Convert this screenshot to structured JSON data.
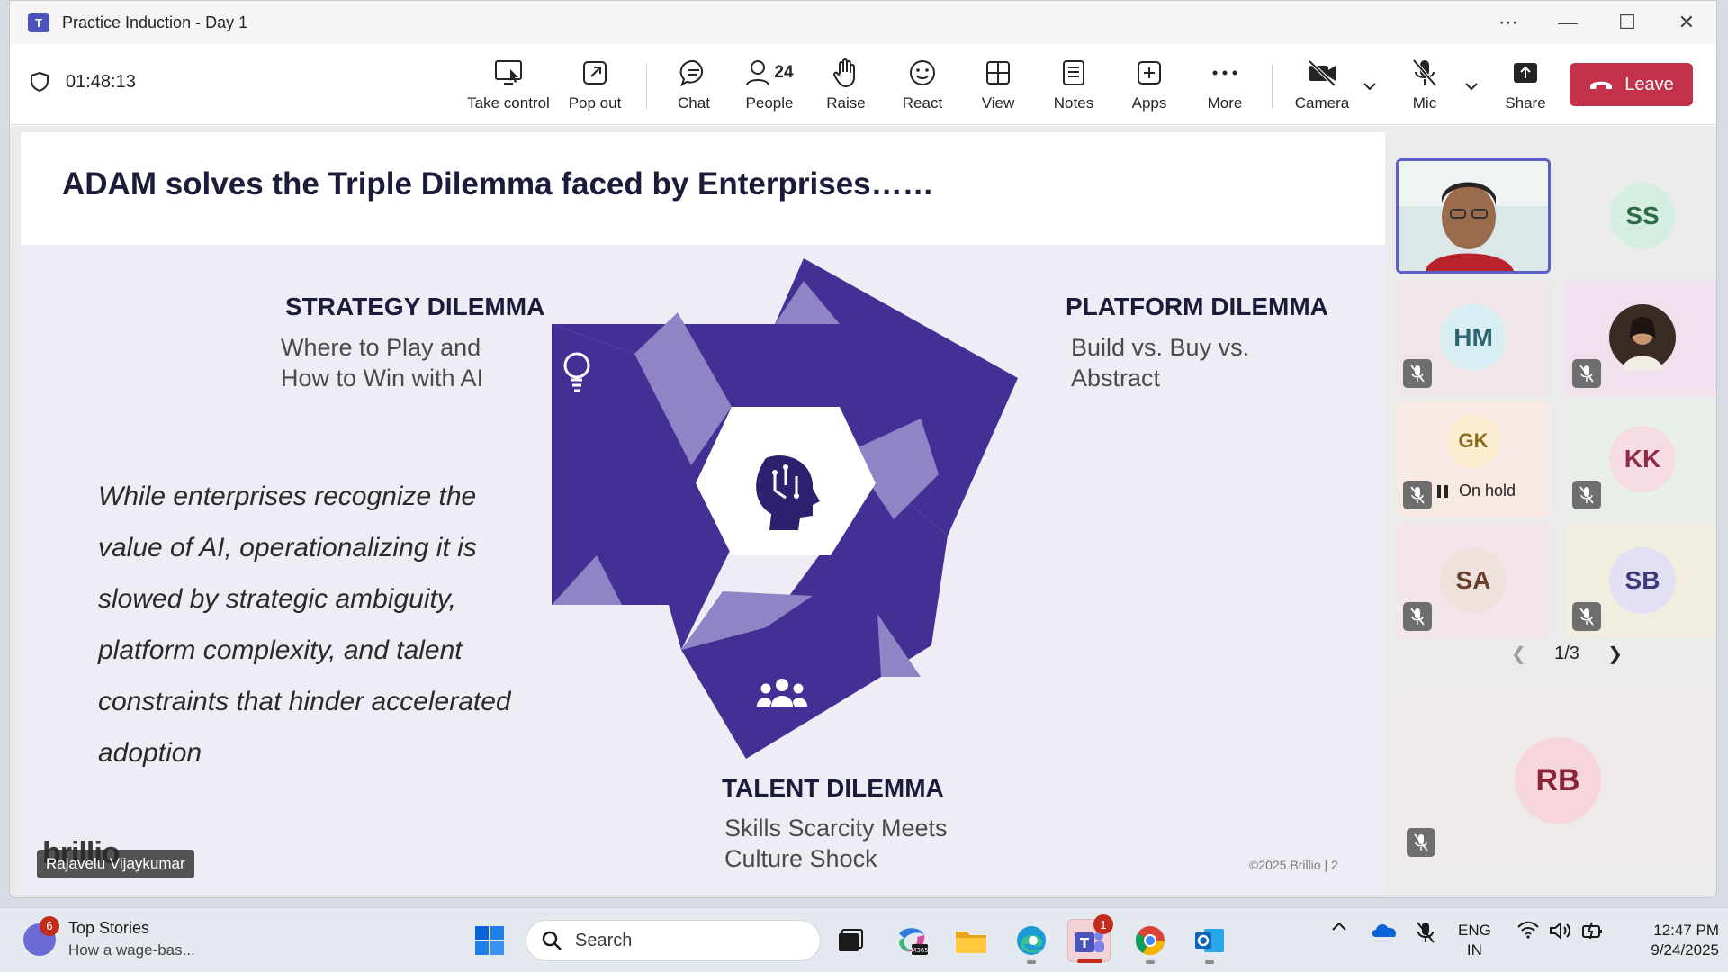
{
  "window": {
    "title": "Practice Induction - Day 1",
    "controls": [
      "…",
      "—",
      "☐",
      "✕"
    ]
  },
  "meeting": {
    "timer": "01:48:13",
    "toolbar": {
      "take_control": "Take control",
      "pop_out": "Pop out",
      "chat": "Chat",
      "people": "People",
      "people_count": "24",
      "raise": "Raise",
      "react": "React",
      "view": "View",
      "notes": "Notes",
      "apps": "Apps",
      "more": "More",
      "camera": "Camera",
      "mic": "Mic",
      "share": "Share",
      "leave": "Leave"
    }
  },
  "slide": {
    "title": "ADAM solves the Triple Dilemma faced by Enterprises……",
    "strategy": {
      "title": "STRATEGY DILEMMA",
      "line1": "Where to Play and",
      "line2": "How to Win with AI"
    },
    "platform": {
      "title": "PLATFORM DILEMMA",
      "line1": "Build vs. Buy vs.",
      "line2": "Abstract"
    },
    "talent": {
      "title": "TALENT DILEMMA",
      "line1": "Skills Scarcity Meets",
      "line2": "Culture Shock"
    },
    "quote": "While enterprises recognize the value of AI, operationalizing it is slowed by strategic ambiguity, platform complexity, and talent constraints that hinder accelerated adoption",
    "copyright": "©2025 Brillio  |  2",
    "logo": "brillio",
    "presenter": "Rajavelu Vijaykumar",
    "colors": {
      "primary": "#442f94",
      "light": "#8f85c6"
    }
  },
  "participants": {
    "tiles": [
      {
        "initials": "",
        "video": true
      },
      {
        "initials": "SS",
        "muted": false
      },
      {
        "initials": "HM",
        "muted": true
      },
      {
        "initials": "",
        "photo": true,
        "muted": true
      },
      {
        "initials": "GK",
        "muted": true,
        "status": "On hold"
      },
      {
        "initials": "KK",
        "muted": true
      },
      {
        "initials": "SA",
        "muted": true
      },
      {
        "initials": "SB",
        "muted": true
      }
    ],
    "pager": "1/3",
    "large_tile": {
      "initials": "RB",
      "muted": true
    }
  },
  "taskbar": {
    "news_badge": "6",
    "news_title": "Top Stories",
    "news_sub": "How a wage-bas...",
    "search": "Search",
    "teams_badge": "1",
    "lang1": "ENG",
    "lang2": "IN",
    "time": "12:47 PM",
    "date": "9/24/2025"
  }
}
